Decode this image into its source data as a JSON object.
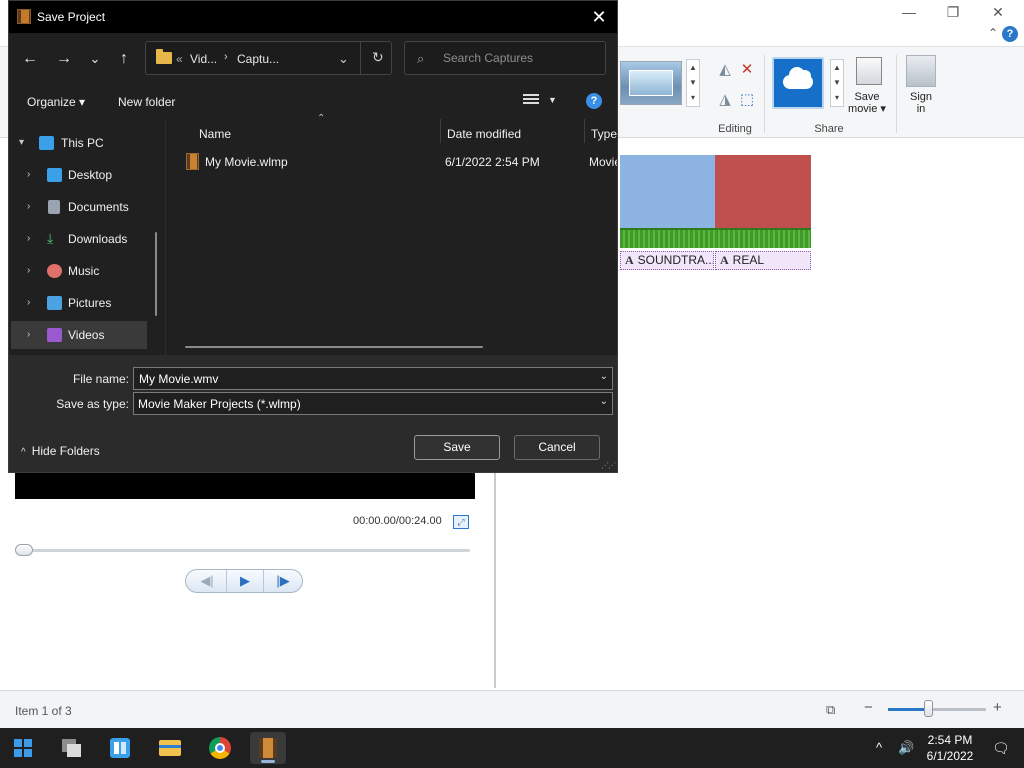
{
  "app": {
    "window_controls": {
      "minimize": "—",
      "maximize": "❐",
      "close": "✕"
    },
    "ribbon": {
      "groups": {
        "editing": "Editing",
        "share": "Share"
      },
      "buttons": {
        "save_movie_line1": "Save",
        "save_movie_line2": "movie ▾",
        "sign_in_line1": "Sign",
        "sign_in_line2": "in"
      }
    },
    "storyboard": {
      "captions": [
        "SOUNDTRA...",
        "REAL"
      ],
      "clip_colors": [
        "#8db3e2",
        "#c0504d"
      ],
      "caption_icon": "A"
    },
    "preview": {
      "time_readout": "00:00.00/00:24.00",
      "play_glyph": "▶"
    },
    "status": {
      "item_text": "Item 1 of 3",
      "zoom_minus": "−",
      "zoom_plus": "+"
    }
  },
  "dialog": {
    "title": "Save Project",
    "close_glyph": "✕",
    "nav": {
      "back": "←",
      "forward": "→",
      "recent": "⌄",
      "up": "↑",
      "refresh": "↻"
    },
    "address": {
      "prefix": "«",
      "segments": [
        "Vid...",
        "Captu..."
      ],
      "separator": "›",
      "dropdown": "⌄"
    },
    "search": {
      "placeholder": "Search Captures",
      "value": ""
    },
    "commands": {
      "organize": "Organize ▾",
      "new_folder": "New folder",
      "help": "?"
    },
    "tree": [
      {
        "label": "This PC",
        "expanded": true,
        "icon": "this-pc-icon"
      },
      {
        "label": "Desktop",
        "icon": "desktop-icon"
      },
      {
        "label": "Documents",
        "icon": "documents-icon"
      },
      {
        "label": "Downloads",
        "icon": "downloads-icon"
      },
      {
        "label": "Music",
        "icon": "music-icon"
      },
      {
        "label": "Pictures",
        "icon": "pictures-icon"
      },
      {
        "label": "Videos",
        "icon": "videos-icon",
        "selected": true
      }
    ],
    "columns": [
      "Name",
      "Date modified",
      "Type"
    ],
    "files": [
      {
        "name": "My Movie.wlmp",
        "date_modified": "6/1/2022 2:54 PM",
        "type": "Movie"
      }
    ],
    "file_name": {
      "label": "File name:",
      "value": "My Movie.wmv"
    },
    "save_as_type": {
      "label": "Save as type:",
      "value": "Movie Maker Projects (*.wlmp)"
    },
    "hide_folders": "Hide Folders",
    "buttons": {
      "save": "Save",
      "cancel": "Cancel"
    }
  },
  "taskbar": {
    "clock": {
      "time": "2:54 PM",
      "date": "6/1/2022"
    },
    "tray": {
      "chevron": "^",
      "volume": "🔊",
      "notification": "🗨"
    }
  },
  "colors": {
    "dialog_bg": "#202020",
    "accent": "#3a8ee6",
    "taskbar": "#1f1f1f"
  }
}
